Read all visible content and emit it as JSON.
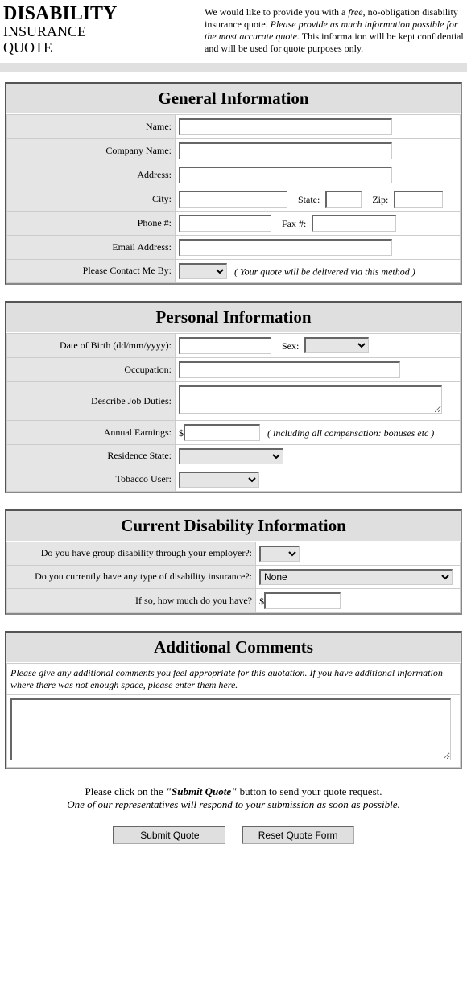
{
  "header": {
    "title": "DISABILITY",
    "sub1": "INSURANCE",
    "sub2": "QUOTE",
    "intro_pre": "We would like to provide you with a ",
    "intro_free": "free",
    "intro_mid": ", no-obligation disability insurance quote. ",
    "intro_emph": "Please provide as much information possible for the most accurate quote.",
    "intro_post": " This information will be kept confidential and will be used for quote purposes only."
  },
  "sections": {
    "general": {
      "title": "General Information",
      "labels": {
        "name": "Name:",
        "company": "Company Name:",
        "address": "Address:",
        "city": "City:",
        "state": "State:",
        "zip": "Zip:",
        "phone": "Phone #:",
        "fax": "Fax #:",
        "email": "Email Address:",
        "contact_by": "Please Contact Me By:",
        "contact_note": "( Your quote will be delivered via this method )"
      }
    },
    "personal": {
      "title": "Personal Information",
      "labels": {
        "dob": "Date of Birth (dd/mm/yyyy):",
        "sex": "Sex:",
        "occupation": "Occupation:",
        "duties": "Describe Job Duties:",
        "earnings": "Annual Earnings:",
        "earnings_prefix": "$",
        "earnings_note": "( including all compensation: bonuses etc )",
        "residence": "Residence State:",
        "tobacco": "Tobacco User:"
      }
    },
    "current": {
      "title": "Current Disability Information",
      "labels": {
        "group_q": "Do you have group disability through your employer?:",
        "any_q": "Do you currently have any type of disability insurance?:",
        "any_default": "None",
        "how_much": "If so, how much do you have?",
        "how_much_prefix": "$"
      }
    },
    "comments": {
      "title": "Additional Comments",
      "note": "Please give any additional comments you feel appropriate for this quotation. If you have additional information where there was not enough space, please enter them here."
    }
  },
  "footer": {
    "line1_pre": "Please click on the ",
    "line1_bold": "\"Submit Quote\"",
    "line1_post": " button to send your quote request.",
    "line2": "One of our representatives will respond to your submission as soon as possible.",
    "submit": "Submit Quote",
    "reset": "Reset Quote Form"
  }
}
